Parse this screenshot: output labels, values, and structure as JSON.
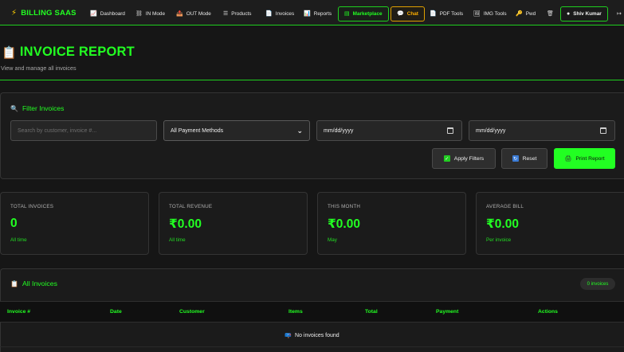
{
  "nav": {
    "brand": "BILLING SAAS",
    "items": [
      {
        "label": "Dashboard",
        "icon": "chart-icon"
      },
      {
        "label": "IN Mode",
        "icon": "network-icon"
      },
      {
        "label": "OUT Mode",
        "icon": "outbox-icon"
      },
      {
        "label": "Products",
        "icon": "list-icon"
      },
      {
        "label": "Invoices",
        "icon": "document-icon"
      },
      {
        "label": "Reports",
        "icon": "bar-chart-icon"
      },
      {
        "label": "Marketplace",
        "icon": "store-icon"
      },
      {
        "label": "Chat",
        "icon": "chat-bubbles-icon"
      },
      {
        "label": "PDF Tools",
        "icon": "pdf-icon"
      },
      {
        "label": "IMG Tools",
        "icon": "image-icon"
      },
      {
        "label": "Pwd",
        "icon": "key-icon"
      }
    ],
    "user": "Shiv Kumar",
    "accent": "#22ff22",
    "chat_color": "#ffb000"
  },
  "header": {
    "title": "INVOICE REPORT",
    "subtitle": "View and manage all invoices"
  },
  "filters": {
    "title": "Filter Invoices",
    "search_placeholder": "Search by customer, invoice #...",
    "payment_method": "All Payment Methods",
    "date_from": "mm/dd/yyyy",
    "date_to": "mm/dd/yyyy",
    "apply_label": "Apply Filters",
    "reset_label": "Reset",
    "print_label": "Print Report"
  },
  "stats": [
    {
      "label": "TOTAL INVOICES",
      "value": "0",
      "note": "All time"
    },
    {
      "label": "TOTAL REVENUE",
      "value": "₹0.00",
      "note": "All time"
    },
    {
      "label": "THIS MONTH",
      "value": "₹0.00",
      "note": "May"
    },
    {
      "label": "AVERAGE BILL",
      "value": "₹0.00",
      "note": "Per invoice"
    }
  ],
  "invoices": {
    "title": "All Invoices",
    "count_badge": "0 invoices",
    "columns": [
      "Invoice #",
      "Date",
      "Customer",
      "Items",
      "Total",
      "Payment",
      "Actions"
    ],
    "empty_message": "No invoices found"
  }
}
